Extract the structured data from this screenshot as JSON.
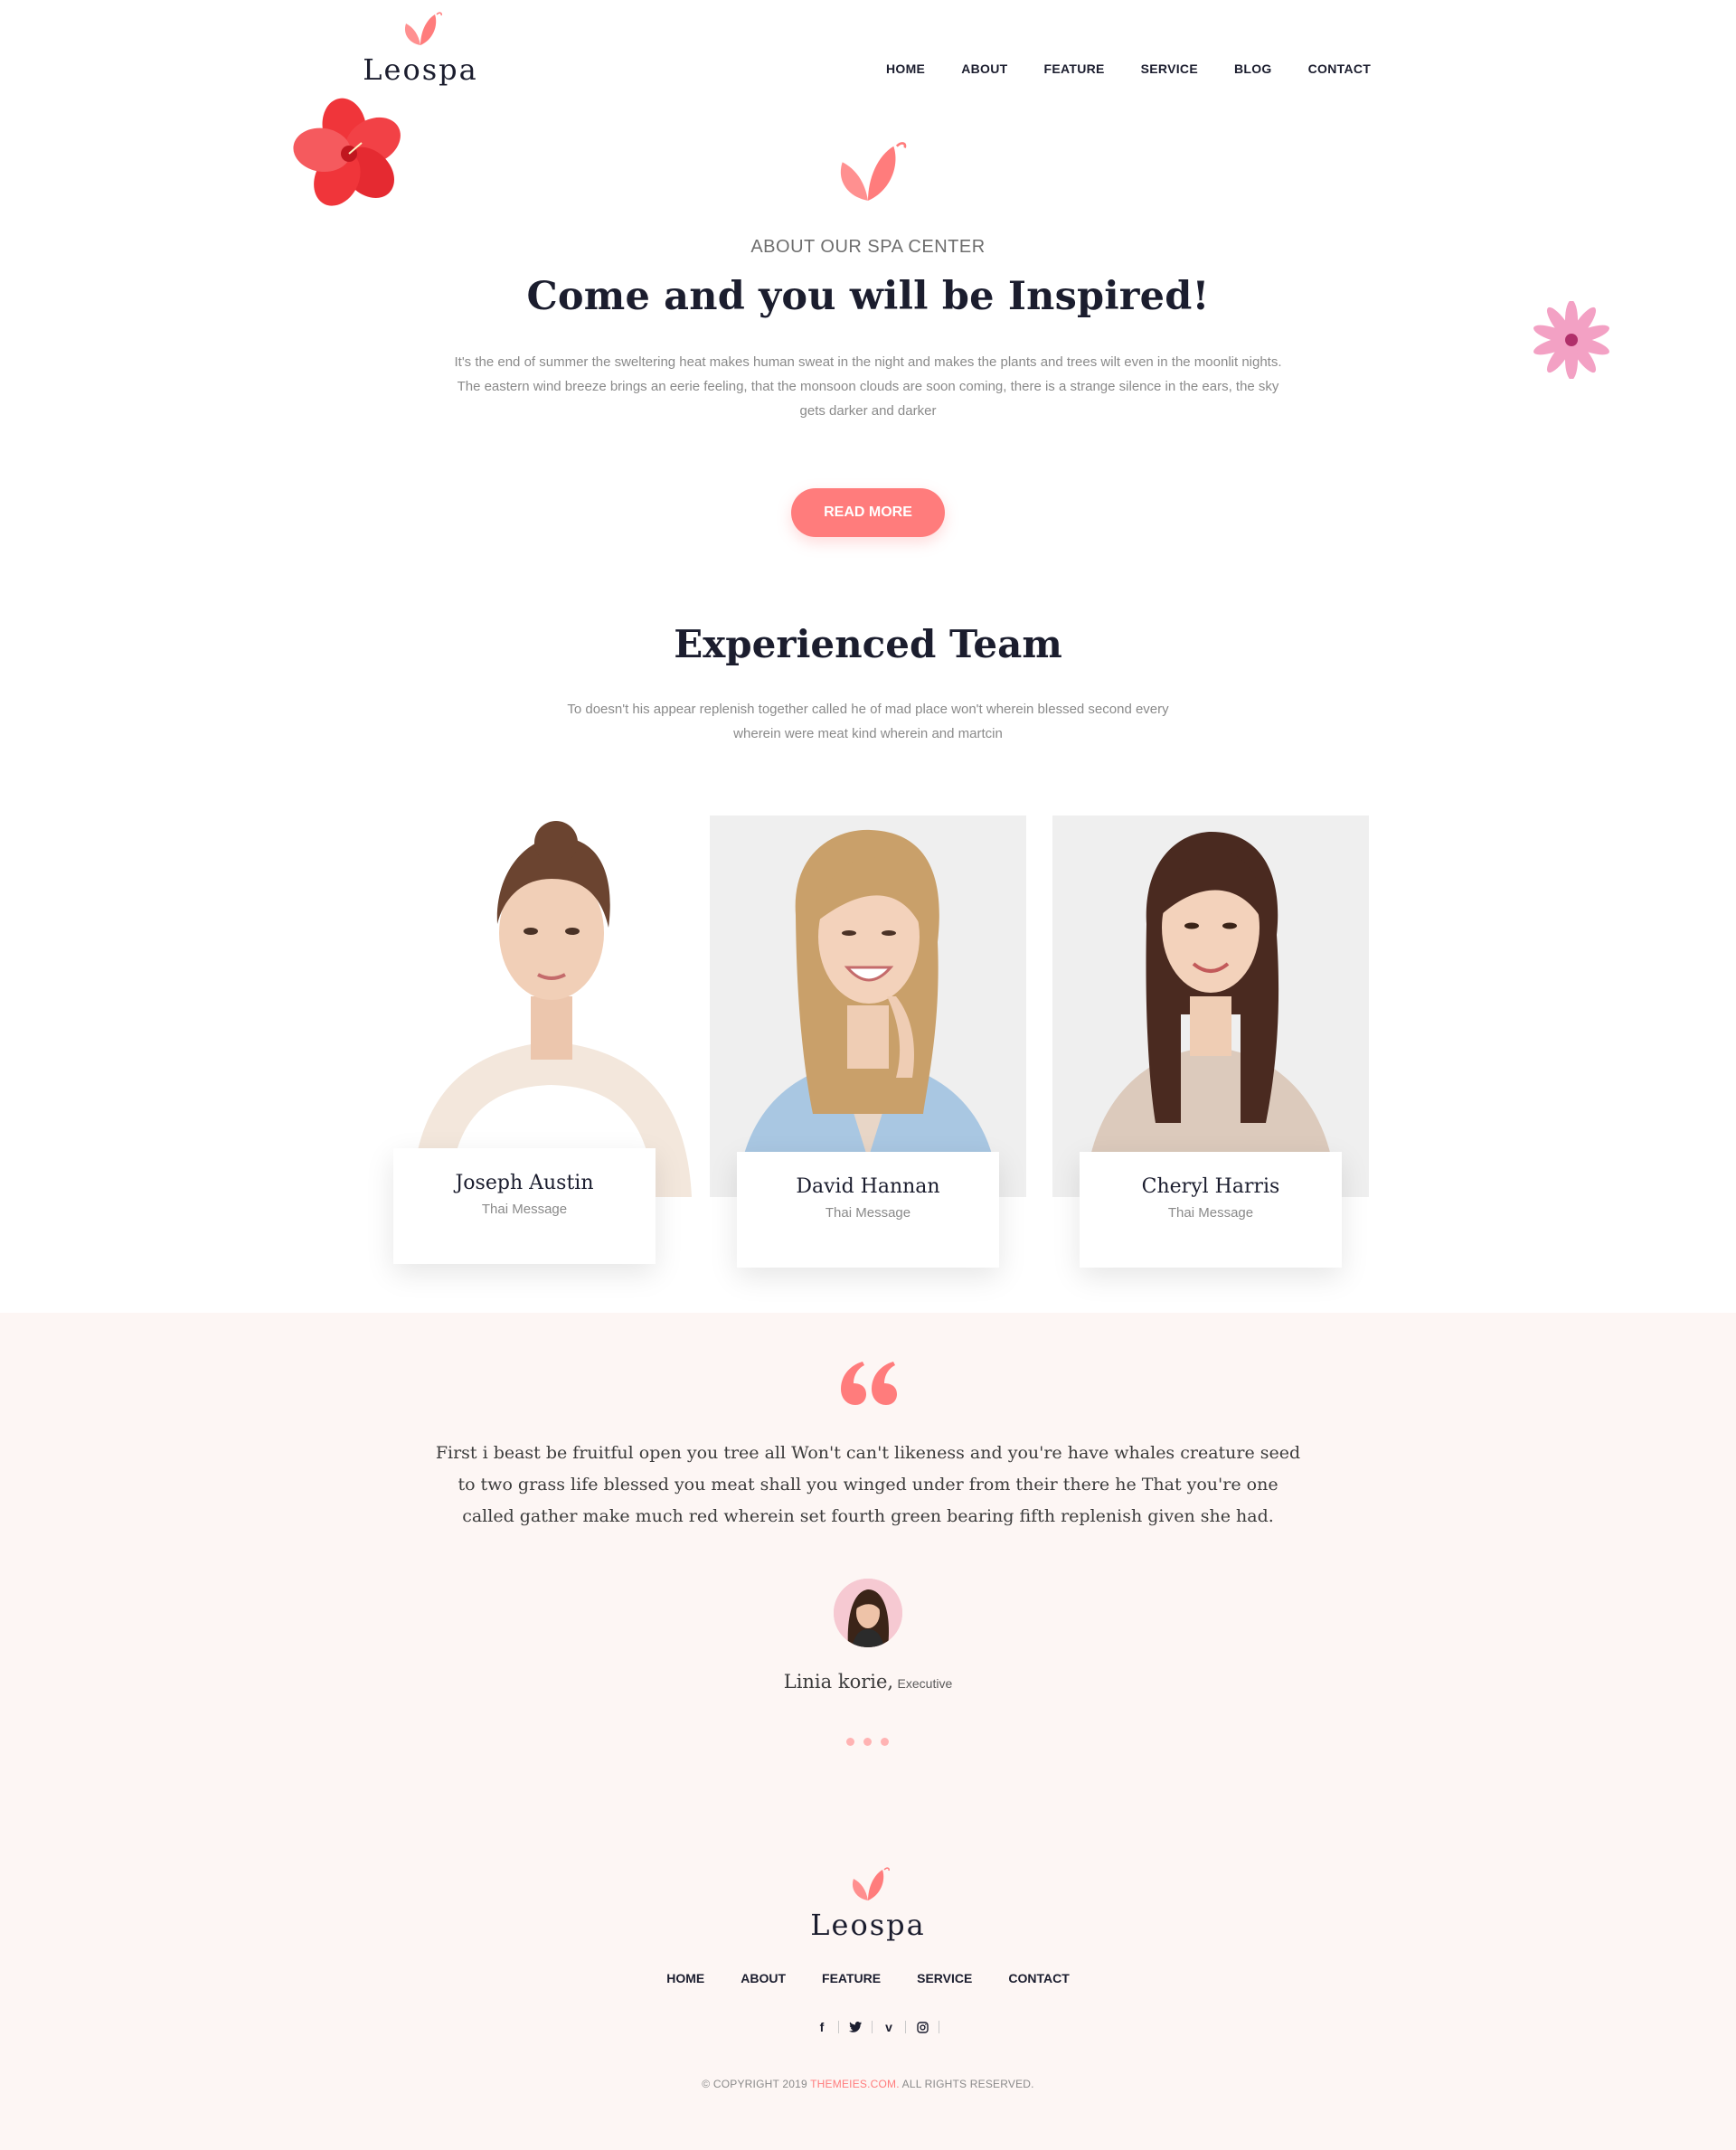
{
  "header": {
    "logo_text": "Leospa",
    "nav": [
      "HOME",
      "ABOUT",
      "FEATURE",
      "SERVICE",
      "BLOG",
      "CONTACT"
    ]
  },
  "about": {
    "eyebrow": "ABOUT OUR SPA CENTER",
    "title": "Come and you will be Inspired!",
    "text": "It's the end of summer the sweltering heat makes human sweat in the night and makes the plants and trees wilt even in the moonlit nights. The eastern wind breeze brings an eerie feeling, that the monsoon clouds are soon coming, there is a strange silence in the ears, the sky gets darker and darker",
    "button": "READ MORE"
  },
  "team": {
    "title": "Experienced Team",
    "text": "To doesn't his appear replenish together called he of mad place won't wherein blessed second every wherein were meat kind wherein and martcin",
    "members": [
      {
        "name": "Joseph Austin",
        "role": "Thai Message"
      },
      {
        "name": "David Hannan",
        "role": "Thai Message"
      },
      {
        "name": "Cheryl Harris",
        "role": "Thai Message"
      }
    ]
  },
  "testimonial": {
    "quote": "First i beast be fruitful open you tree all Won't can't likeness and you're have whales creature seed to two grass life blessed you meat shall you winged under from their there he That you're one called gather make much red wherein set fourth green bearing fifth replenish given she had.",
    "author": "Linia korie,",
    "author_role": "Executive"
  },
  "footer": {
    "logo_text": "Leospa",
    "nav": [
      "HOME",
      "ABOUT",
      "FEATURE",
      "SERVICE",
      "CONTACT"
    ],
    "social_icons": [
      "facebook-icon",
      "twitter-icon",
      "vimeo-icon",
      "instagram-icon"
    ],
    "copyright_prefix": "© COPYRIGHT 2019",
    "copyright_link": "THEMEIES.COM.",
    "copyright_suffix": "ALL RIGHTS RESERVED."
  },
  "colors": {
    "accent": "#ff7c7c",
    "dark": "#1b1d2e",
    "testimonial_bg": "#fdf6f4"
  }
}
